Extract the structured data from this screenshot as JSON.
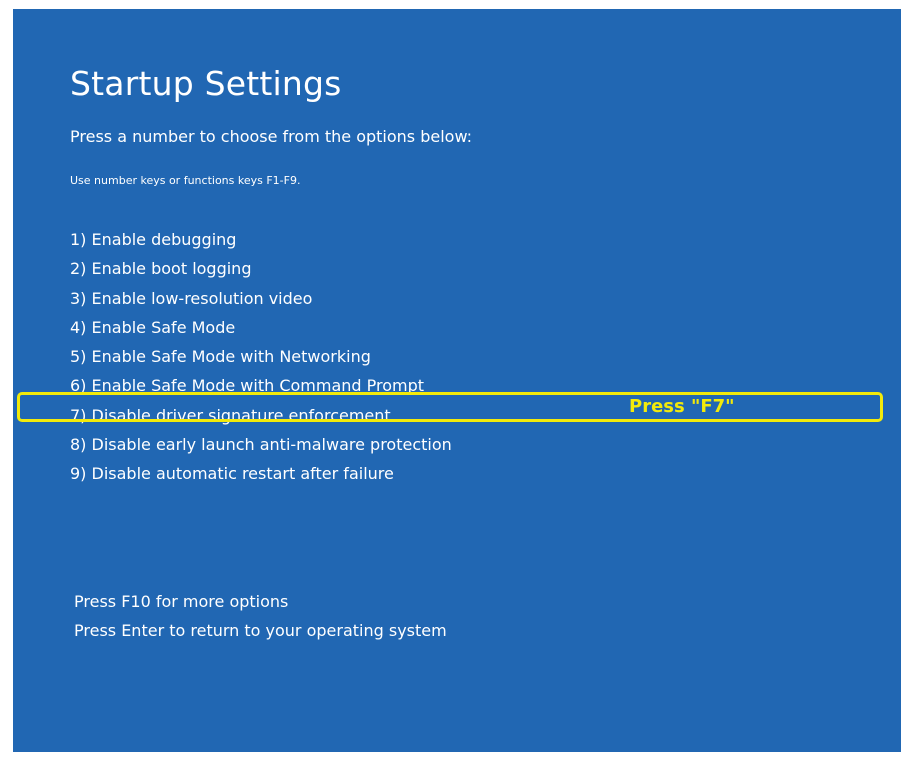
{
  "screen": {
    "title": "Startup Settings",
    "subtitle": "Press a number to choose from the options below:",
    "hint": "Use number keys or functions keys F1-F9.",
    "options": [
      "1) Enable debugging",
      "2) Enable boot logging",
      "3) Enable low-resolution video",
      "4) Enable Safe Mode",
      "5) Enable Safe Mode with Networking",
      "6) Enable Safe Mode with Command Prompt",
      "7) Disable driver signature enforcement",
      "8) Disable early launch anti-malware protection",
      "9) Disable automatic restart after failure"
    ],
    "footer": {
      "more_options": "Press F10 for more options",
      "return": "Press Enter to return to your operating system"
    }
  },
  "annotation": {
    "label": "Press \"F7\"",
    "highlighted_option": "7) Disable driver signature enforcement",
    "color": "#f2ea0b"
  },
  "colors": {
    "background": "#2167b3",
    "text": "#ffffff",
    "annotation": "#f2ea0b"
  }
}
